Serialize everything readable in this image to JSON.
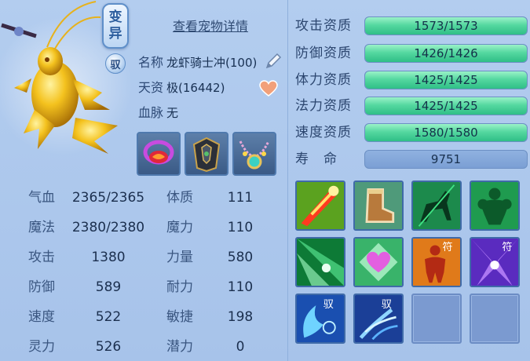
{
  "pet_panel": {
    "mutant_badge": [
      "变",
      "异"
    ],
    "tame_badge": "驭",
    "detail_link": "查看宠物详情",
    "name": {
      "label": "名称",
      "value": "龙虾骑士冲(100)"
    },
    "talent": {
      "label": "天资",
      "value": "极(16442)"
    },
    "bloodline": {
      "label": "血脉",
      "value": "无"
    },
    "equipment": [
      "collar-equip-icon",
      "armor-equip-icon",
      "amulet-equip-icon"
    ]
  },
  "stats": [
    {
      "left_label": "气血",
      "left_value": "2365/2365",
      "right_label": "体质",
      "right_value": "111"
    },
    {
      "left_label": "魔法",
      "left_value": "2380/2380",
      "right_label": "魔力",
      "right_value": "110"
    },
    {
      "left_label": "攻击",
      "left_value": "1380",
      "right_label": "力量",
      "right_value": "580"
    },
    {
      "left_label": "防御",
      "left_value": "589",
      "right_label": "耐力",
      "right_value": "110"
    },
    {
      "left_label": "速度",
      "left_value": "522",
      "right_label": "敏捷",
      "right_value": "198"
    },
    {
      "left_label": "灵力",
      "left_value": "526",
      "right_label": "潜力",
      "right_value": "0"
    }
  ],
  "aptitudes": [
    {
      "label": "攻击资质",
      "value": "1573/1573",
      "fill": 1.0
    },
    {
      "label": "防御资质",
      "value": "1426/1426",
      "fill": 1.0
    },
    {
      "label": "体力资质",
      "value": "1425/1425",
      "fill": 1.0
    },
    {
      "label": "法力资质",
      "value": "1425/1425",
      "fill": 1.0
    },
    {
      "label": "速度资质",
      "value": "1580/1580",
      "fill": 1.0
    }
  ],
  "lifespan": {
    "label": "寿　命",
    "value": "9751"
  },
  "skills": [
    {
      "icon": "blade-skill-icon",
      "badge": ""
    },
    {
      "icon": "boot-skill-icon",
      "badge": ""
    },
    {
      "icon": "horse-skill-icon",
      "badge": ""
    },
    {
      "icon": "muscle-skill-icon",
      "badge": ""
    },
    {
      "icon": "green-light-skill-icon",
      "badge": ""
    },
    {
      "icon": "heart-skill-icon",
      "badge": ""
    },
    {
      "icon": "figure-skill-icon",
      "badge": "符"
    },
    {
      "icon": "purple-burst-skill-icon",
      "badge": "符"
    },
    {
      "icon": "wave-skill-icon",
      "badge": "驭"
    },
    {
      "icon": "claw-skill-icon",
      "badge": "驭"
    }
  ],
  "colors": {
    "background": "#b3cdef",
    "bar_fill": "#3fcc8f",
    "skill_border": "#3f6aa8"
  }
}
